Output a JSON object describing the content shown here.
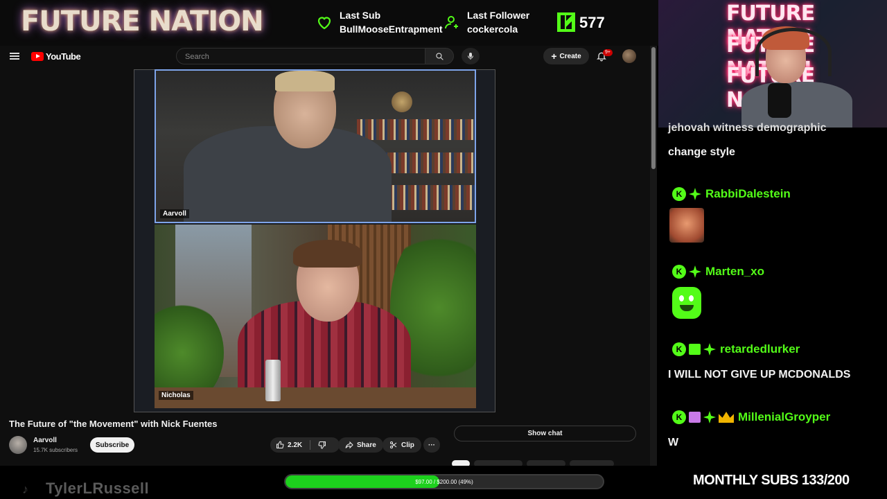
{
  "overlay": {
    "brand": "FUTURE NATION",
    "last_sub_label": "Last Sub",
    "last_sub_name": "BullMooseEntrapment",
    "last_follower_label": "Last Follower",
    "last_follower_name": "cockercola",
    "kick_viewers": "577",
    "watermark": "TylerLRussell",
    "progress_text": "$97.00 / $200.00 (49%)",
    "progress_fraction": 0.485,
    "monthly_subs": "MONTHLY SUBS 133/200",
    "accent_color": "#53fc18"
  },
  "youtube": {
    "logo_text": "YouTube",
    "search_placeholder": "Search",
    "create_label": "Create",
    "notif_badge": "9+",
    "video": {
      "title": "The Future of \"the Movement\" with Nick Fuentes",
      "participant_top": "Aarvoll",
      "participant_bottom": "Nicholas"
    },
    "channel": {
      "name": "Aarvoll",
      "subscribers": "15.7K subscribers",
      "subscribe_label": "Subscribe"
    },
    "actions": {
      "likes": "2.2K",
      "share_label": "Share",
      "clip_label": "Clip",
      "more_label": "···"
    },
    "show_chat_label": "Show chat"
  },
  "webcam": {
    "neon_lines": [
      "FUTURE NATION",
      "FUTURE NATION",
      "FUTURE NATION"
    ]
  },
  "chat": {
    "cut_line": "jehovah witness demographic",
    "first_text": "change style",
    "messages": [
      {
        "user": "RabbiDalestein",
        "text": ""
      },
      {
        "user": "Marten_xo",
        "text": ""
      },
      {
        "user": "retardedlurker",
        "text": "I WILL NOT GIVE UP MCDONALDS"
      },
      {
        "user": "MillenialGroyper",
        "text": "W"
      }
    ]
  }
}
